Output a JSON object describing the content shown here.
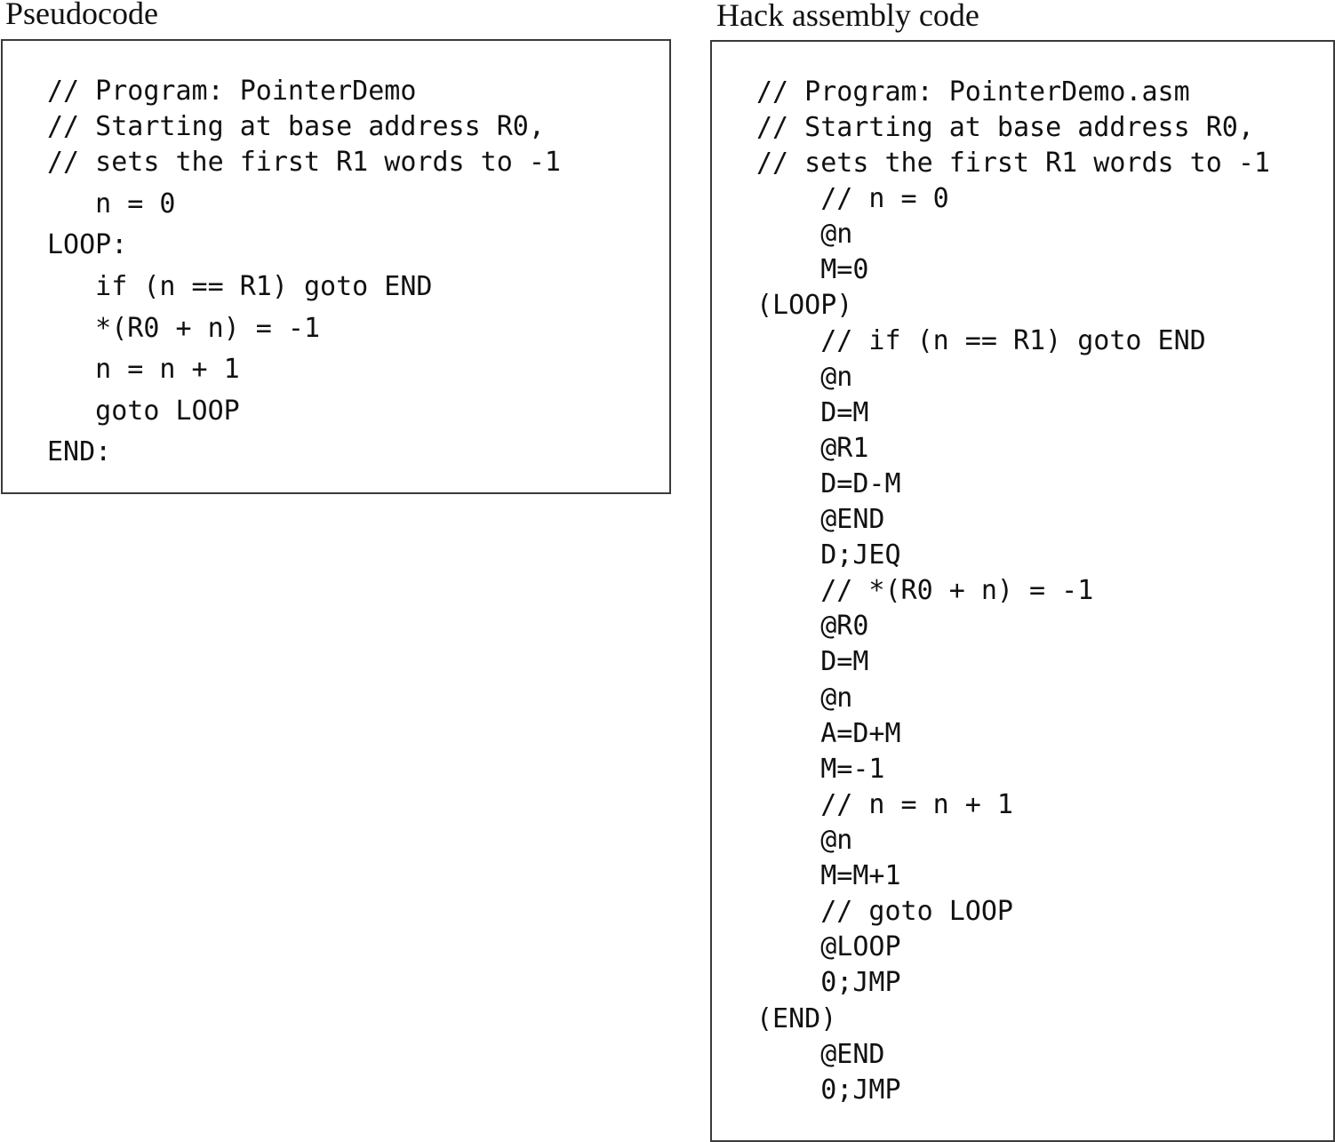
{
  "pseudocode": {
    "title": "Pseudocode",
    "lines": [
      "// Program: PointerDemo",
      "// Starting at base address R0,",
      "// sets the first R1 words to -1",
      "   n = 0",
      "LOOP:",
      "   if (n == R1) goto END",
      "   *(R0 + n) = -1",
      "   n = n + 1",
      "   goto LOOP",
      "END:"
    ]
  },
  "assembly": {
    "title": "Hack assembly code",
    "lines": [
      "// Program: PointerDemo.asm",
      "// Starting at base address R0,",
      "// sets the first R1 words to -1",
      "    // n = 0",
      "    @n",
      "    M=0",
      "(LOOP)",
      "    // if (n == R1) goto END",
      "    @n",
      "    D=M",
      "    @R1",
      "    D=D-M",
      "    @END",
      "    D;JEQ",
      "    // *(R0 + n) = -1",
      "    @R0",
      "    D=M",
      "    @n",
      "    A=D+M",
      "    M=-1",
      "    // n = n + 1",
      "    @n",
      "    M=M+1",
      "    // goto LOOP",
      "    @LOOP",
      "    0;JMP",
      "(END)",
      "    @END",
      "    0;JMP"
    ]
  }
}
